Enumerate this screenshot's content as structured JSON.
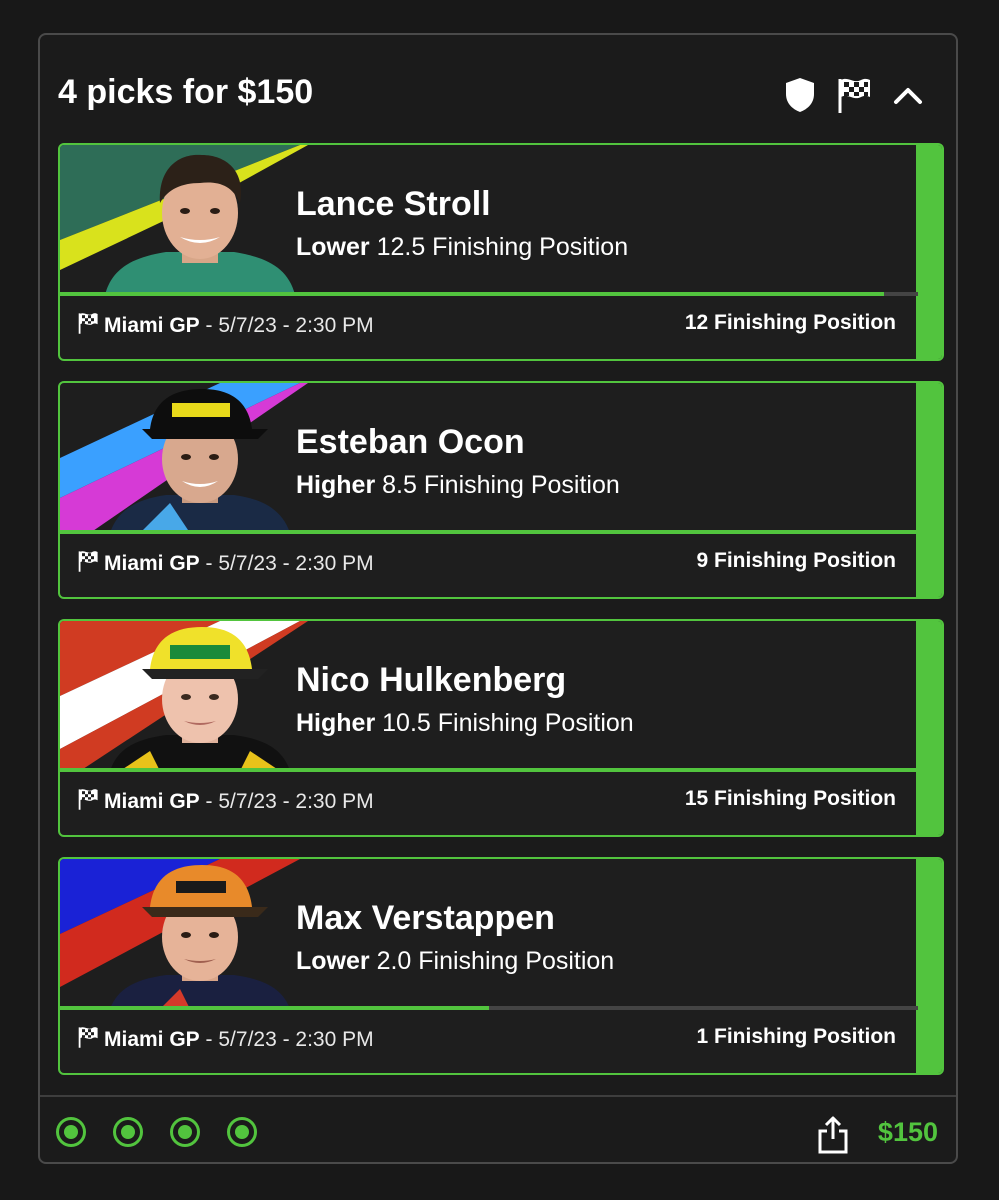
{
  "header": {
    "title": "4 picks for $150",
    "icons": [
      "shield-icon",
      "checkered-flag-icon",
      "chevron-up-icon"
    ]
  },
  "picks": [
    {
      "name": "Lance Stroll",
      "direction": "Lower",
      "line": "12.5 Finishing Position",
      "event": "Miami GP",
      "datetime": "- 5/7/23 - 2:30 PM",
      "result": "12 Finishing Position",
      "progress": 0.96,
      "stripe_colors": [
        "#2e6d57",
        "#d9e21c",
        "#ffffff"
      ]
    },
    {
      "name": "Esteban Ocon",
      "direction": "Higher",
      "line": "8.5 Finishing Position",
      "event": "Miami GP",
      "datetime": "- 5/7/23 - 2:30 PM",
      "result": "9 Finishing Position",
      "progress": 1.0,
      "stripe_colors": [
        "#3aa0ff",
        "#d63ad6",
        "#ffffff"
      ]
    },
    {
      "name": "Nico Hulkenberg",
      "direction": "Higher",
      "line": "10.5 Finishing Position",
      "event": "Miami GP",
      "datetime": "- 5/7/23 - 2:30 PM",
      "result": "15 Finishing Position",
      "progress": 1.0,
      "stripe_colors": [
        "#d03b22",
        "#ffffff",
        "#d03b22"
      ]
    },
    {
      "name": "Max Verstappen",
      "direction": "Lower",
      "line": "2.0 Finishing Position",
      "event": "Miami GP",
      "datetime": "- 5/7/23 - 2:30 PM",
      "result": "1 Finishing Position",
      "progress": 0.5,
      "stripe_colors": [
        "#1a22d6",
        "#d12a1e",
        "#ffffff"
      ]
    }
  ],
  "footer": {
    "amount": "$150",
    "status_dots": 4
  },
  "colors": {
    "accent": "#52c43e",
    "background": "#181818",
    "card_border": "#4a4a4a"
  }
}
